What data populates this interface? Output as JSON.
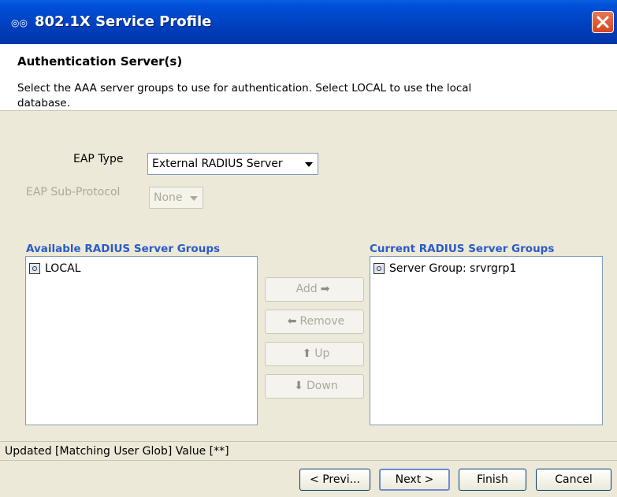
{
  "window": {
    "title": "802.1X Service Profile",
    "icon": "app-icon",
    "close_icon": "close-icon"
  },
  "header": {
    "title": "Authentication Server(s)",
    "description": "Select the AAA server groups to use for authentication. Select LOCAL to use the local database."
  },
  "form": {
    "eap_type_label": "EAP Type",
    "eap_type_value": "External RADIUS Server",
    "eap_sub_label": "EAP Sub-Protocol",
    "eap_sub_value": "None"
  },
  "available": {
    "label": "Available RADIUS Server Groups",
    "items": [
      "LOCAL"
    ]
  },
  "current": {
    "label": "Current RADIUS Server Groups",
    "items": [
      "Server Group: srvrgrp1"
    ]
  },
  "actions": {
    "add": "Add",
    "remove": "Remove",
    "up": "Up",
    "down": "Down"
  },
  "status": "Updated [Matching User Glob] Value [**]",
  "footer": {
    "prev": "< Previ...",
    "next": "Next >",
    "finish": "Finish",
    "cancel": "Cancel"
  }
}
